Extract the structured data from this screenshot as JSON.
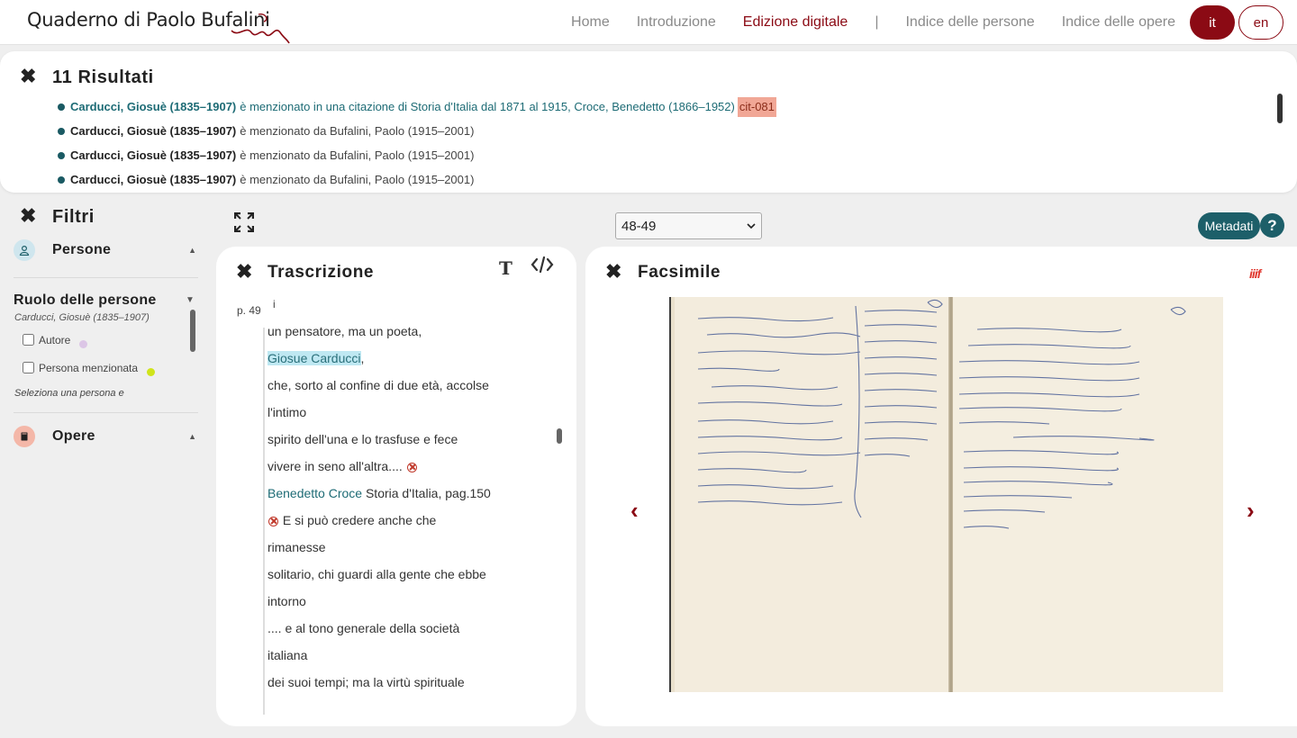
{
  "header": {
    "logo_text": "Quaderno di Paolo Bufalini",
    "nav": [
      "Home",
      "Introduzione",
      "Edizione digitale",
      "|",
      "Indice delle persone",
      "Indice delle opere"
    ],
    "active_nav": "Edizione digitale",
    "lang_it": "it",
    "lang_en": "en",
    "accent_color": "#8b0a14"
  },
  "results": {
    "title": "11 Risultati",
    "items": [
      {
        "person": "Carducci, Giosuè (1835–1907)",
        "text": "è menzionato in una citazione di Storia d'Italia dal 1871 al 1915, Croce, Benedetto (1866–1952)",
        "tag": "cit-081"
      },
      {
        "person": "Carducci, Giosuè (1835–1907)",
        "text": "è menzionato da Bufalini, Paolo (1915–2001)"
      },
      {
        "person": "Carducci, Giosuè (1835–1907)",
        "text": "è menzionato da Bufalini, Paolo (1915–2001)"
      },
      {
        "person": "Carducci, Giosuè (1835–1907)",
        "text": "è menzionato da Bufalini, Paolo (1915–2001)"
      }
    ]
  },
  "filters": {
    "title": "Filtri",
    "persone": "Persone",
    "ruolo_title": "Ruolo delle persone",
    "ruolo_sub": "Carducci, Giosuè (1835–1907)",
    "autore": "Autore",
    "persona_menzionata": "Persona menzionata",
    "hint": "Seleziona una persona e",
    "opere": "Opere"
  },
  "toolbar": {
    "page_select": "48-49",
    "metadati": "Metadati",
    "help": "?"
  },
  "transcription": {
    "title": "Trascrizione",
    "page_label": "p. 49",
    "line_top": "i",
    "lines": [
      "un pensatore, ma un poeta,",
      "Giosue Carducci",
      ",",
      "che, sorto al confine di due età, accolse",
      "l'intimo",
      "spirito dell'una e lo trasfuse e fece",
      "vivere in seno all'altra....",
      "Benedetto Croce",
      " Storia d'Italia, pag.150",
      " E si può credere anche che",
      "rimanesse",
      "solitario, chi guardi alla gente che ebbe",
      "intorno",
      ".... e al tono generale della società",
      "italiana",
      "dei suoi tempi; ma la virtù spirituale"
    ]
  },
  "facsimile": {
    "title": "Facsimile",
    "iiif_a": "iii",
    "iiif_b": "f",
    "prev": "‹",
    "next": "›"
  }
}
